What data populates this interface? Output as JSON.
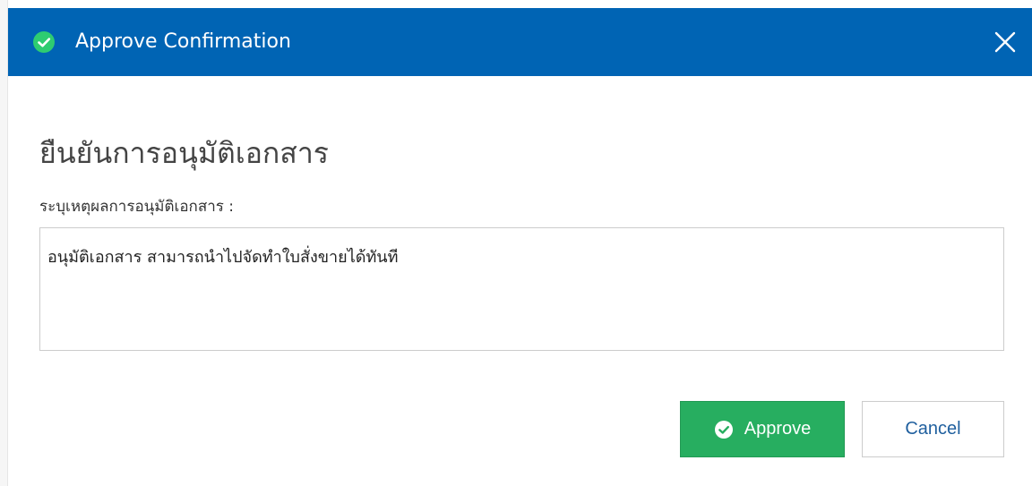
{
  "dialog": {
    "title": "Approve Confirmation",
    "heading": "ยืนยันการอนุมัติเอกสาร",
    "field_label": "ระบุเหตุผลการอนุมัติเอกสาร :",
    "reason_value": "อนุมัติเอกสาร สามารถนำไปจัดทำใบสั่งขายได้ทันที",
    "approve_label": "Approve",
    "cancel_label": "Cancel"
  },
  "icons": {
    "header": "check-circle-icon",
    "close": "close-icon",
    "approve": "check-circle-icon"
  },
  "colors": {
    "header_bg": "#0064b4",
    "check_green": "#2ecc71",
    "approve_bg": "#27ae60",
    "cancel_text": "#1f5f9e"
  }
}
